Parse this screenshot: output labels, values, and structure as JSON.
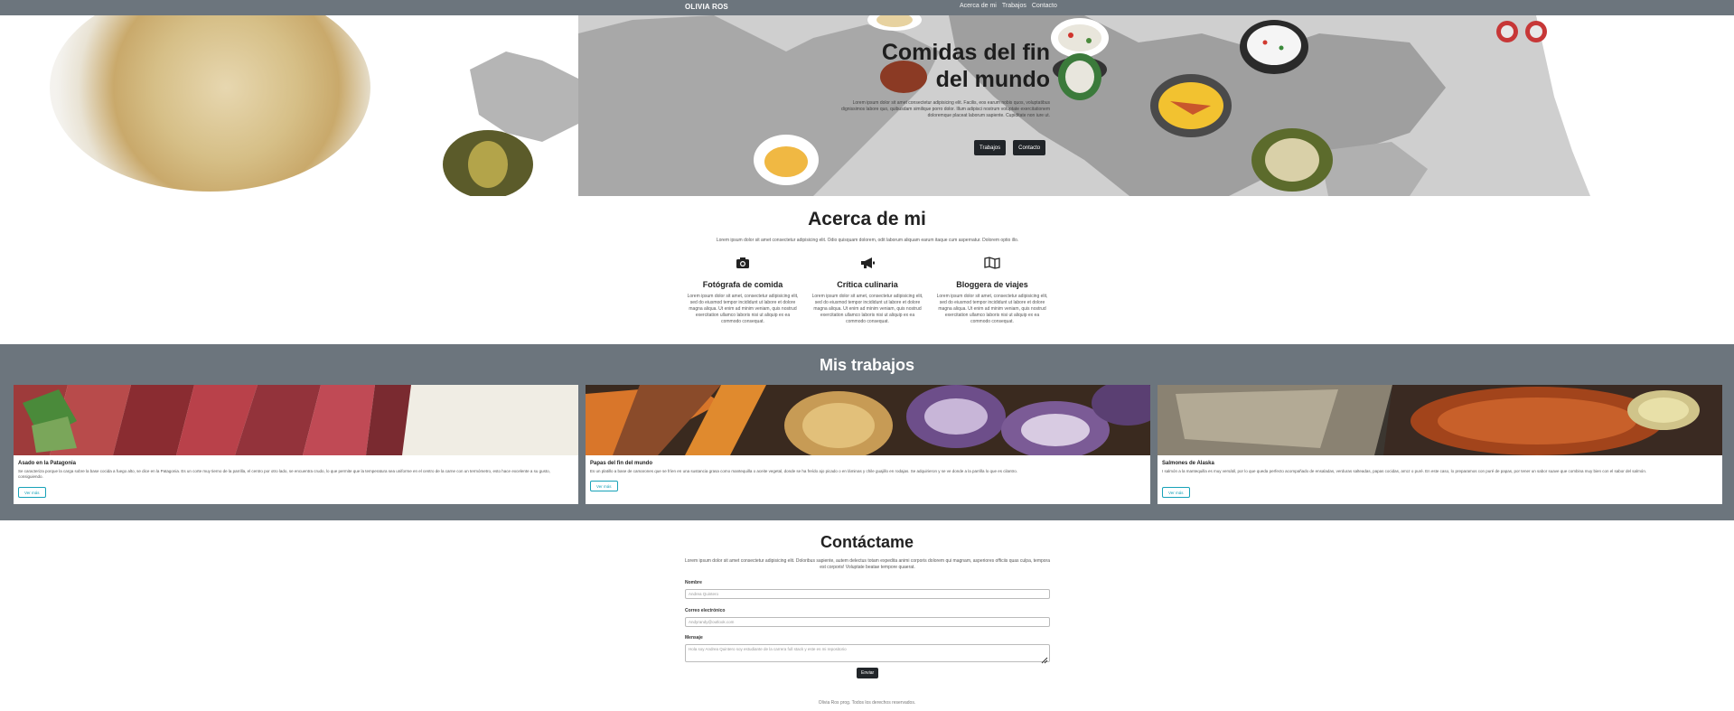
{
  "navbar": {
    "brand": "OLIVIA ROS",
    "links": [
      "Acerca de mi",
      "Trabajos",
      "Contacto"
    ]
  },
  "hero": {
    "title_line1": "Comidas del fin",
    "title_line2": "del mundo",
    "description": "Lorem ipsum dolor sit amet consectetur adipisicing elit. Facilis, eos earum nobis quos, voluptatibus dignissimos labore quo, quibusdam similique porro dolor. Illum adipisci nostrum voluptate exercitationem doloremque placeat laborum sapiente. Cupiditate non iure ut.",
    "buttons": [
      "Trabajos",
      "Contacto"
    ]
  },
  "about": {
    "title": "Acerca de mi",
    "lead": "Lorem ipsum dolor sit amet consectetur adipisicing elit. Odio quisquam dolorem, odit laborum aliquam earum itaque cum aspernatur. Dolorem optio illo.",
    "features": [
      {
        "icon": "camera-icon",
        "title": "Fotógrafa de comida",
        "desc": "Lorem ipsum dolor sit amet, consectetur adipisicing elit, sed do eiusmod tempor incididunt ut labore et dolore magna aliqua. Ut enim ad minim veniam, quis nostrud exercitation ullamco laboris nisi ut aliquip ex ea commodo consequat."
      },
      {
        "icon": "megaphone-icon",
        "title": "Crítica culinaria",
        "desc": "Lorem ipsum dolor sit amet, consectetur adipisicing elit, sed do eiusmod tempor incididunt ut labore et dolore magna aliqua. Ut enim ad minim veniam, quis nostrud exercitation ullamco laboris nisi ut aliquip ex ea commodo consequat."
      },
      {
        "icon": "map-icon",
        "title": "Bloggera de viajes",
        "desc": "Lorem ipsum dolor sit amet, consectetur adipisicing elit, sed do eiusmod tempor incididunt ut labore et dolore magna aliqua. Ut enim ad minim veniam, quis nostrud exercitation ullamco laboris nisi ut aliquip ex ea commodo consequat."
      }
    ]
  },
  "works": {
    "title": "Mis trabajos",
    "button_label": "Ver más",
    "cards": [
      {
        "title": "Asado en la Patagonia",
        "text": "Se caracteriza porque la carga sobre la base cocida a fuego alto, se dice en la Patagonia. Es un corte muy tierno de la parrilla, el centro por otro lado, se encuentra crudo, lo que permite que la temperatura sea uniforme en el centro de la carne con un termómetro, esto hace excelente a su gusto, consiguiendo."
      },
      {
        "title": "Papas del fin del mundo",
        "text": "Es un platillo a base de camarones que se fríen en una sustancia grasa como mantequilla o aceite vegetal, donde se ha freído ajo picado o en láminas y chile guajillo en rodajas. Se adquirieron y se ve donde a la parrilla lo que es cilantro."
      },
      {
        "title": "Salmones de Alaska",
        "text": "I salmón a la mantequilla es muy versátil, por lo que queda perfecto acompañado de ensaladas, verduras salteadas, papas cocidas, arroz o puré. En este caso, lo preparamos con puré de papas, por tener un sabor suave que combina muy bien con el sabor del salmón."
      }
    ]
  },
  "contact": {
    "title": "Contáctame",
    "lead": "Lorem ipsum dolor sit amet consectetur adipisicing elit. Doloribus sapiente, autem delectus totam expedita animi corporis dolorem qui magnam, asperiores officiis quas culpa, tempora est corporis! Voluptate beatae tempore quaerat.",
    "name_label": "Nombre",
    "name_value": "Andrea Quintero",
    "email_label": "Correo electrónico",
    "email_value": "Andyrandy@outlook.com",
    "message_label": "Mensaje",
    "message_value": "Hola soy Andrea Quintero soy estudiante de la carrera full stack y este es mi repositorio",
    "submit_label": "Enviar"
  },
  "footer": {
    "text": "Olivia Ros prog. Todos los derechos reservados."
  },
  "colors": {
    "navbar": "#6c757d",
    "works_bg": "#6c757d",
    "dark_button": "#212529",
    "accent": "#17a2b8"
  }
}
